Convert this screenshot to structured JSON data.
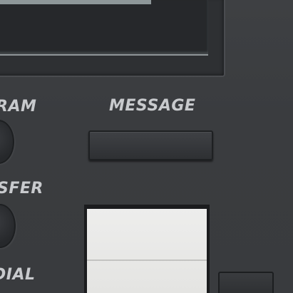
{
  "labels": {
    "program": "RAM",
    "message": "MESSAGE",
    "transfer": "SFER",
    "redial": "DIAL"
  },
  "colors": {
    "body": "#3b3d40",
    "label": "#c8cacd",
    "paper": "#ededec"
  }
}
